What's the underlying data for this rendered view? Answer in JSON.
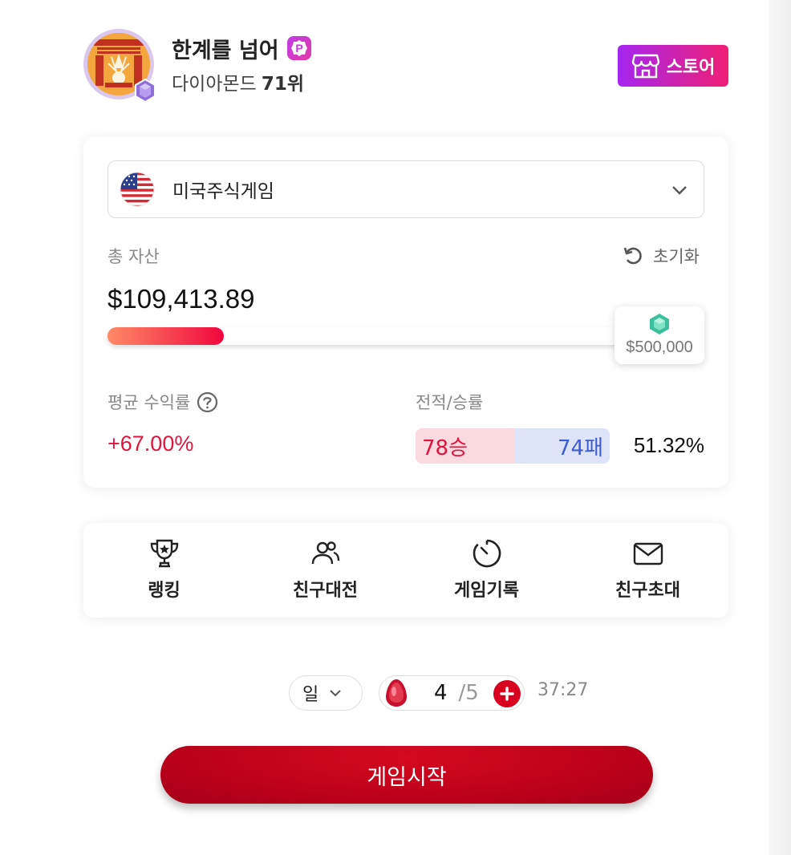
{
  "profile": {
    "nickname": "한계를 넘어",
    "badge_letter": "P",
    "tier": "다이아몬드",
    "rank": "71위"
  },
  "store": {
    "label": "스토어"
  },
  "market": {
    "name": "미국주식게임"
  },
  "assets": {
    "label": "총 자산",
    "value": "$109,413.89",
    "reset_label": "초기화",
    "goal_label": "$500,000",
    "progress_fraction": 0.22
  },
  "stats": {
    "avg_return_label": "평균 수익률",
    "avg_return_value": "+67.00%",
    "record_label": "전적/승률",
    "wins": "78승",
    "losses": "74패",
    "win_rate": "51.32%",
    "win_fraction": 0.5132
  },
  "menu": [
    {
      "label": "랭킹",
      "icon": "trophy-icon"
    },
    {
      "label": "친구대전",
      "icon": "friends-icon"
    },
    {
      "label": "게임기록",
      "icon": "timer-icon"
    },
    {
      "label": "친구초대",
      "icon": "mail-icon"
    }
  ],
  "controls": {
    "unit": "일",
    "energy_current": "4",
    "energy_max": "/5",
    "timer": "37:27"
  },
  "start": {
    "label": "게임시작"
  },
  "colors": {
    "accent_red": "#d8001e",
    "store_gradient_start": "#a526f0",
    "store_gradient_end": "#f01f74",
    "profit_red": "#e0143c",
    "loss_blue": "#3d5bd8"
  }
}
